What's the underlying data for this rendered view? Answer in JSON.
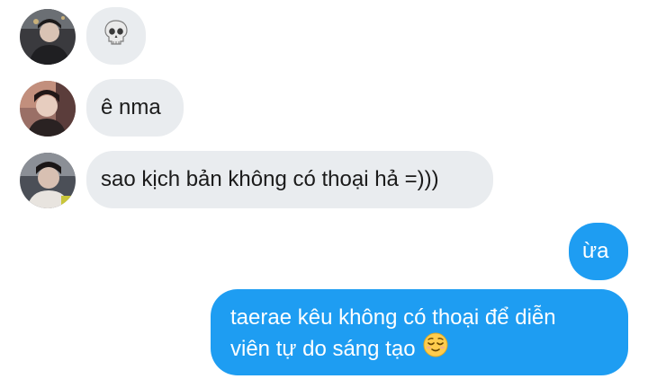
{
  "messages": [
    {
      "sender": "other",
      "text": "💀",
      "icon": "skull-emoji"
    },
    {
      "sender": "other",
      "text": "ê nma"
    },
    {
      "sender": "other",
      "text": "sao kịch bản không có thoại hả =)))"
    },
    {
      "sender": "me",
      "text": "ừa"
    },
    {
      "sender": "me",
      "line1": "taerae kêu không có thoại để diễn",
      "line2": "viên tự do sáng tạo",
      "icon": "relieved-face-emoji"
    }
  ],
  "colors": {
    "incoming_bubble": "#e9ecef",
    "outgoing_bubble": "#1e9df2",
    "incoming_text": "#1b1b1b",
    "outgoing_text": "#ffffff"
  }
}
